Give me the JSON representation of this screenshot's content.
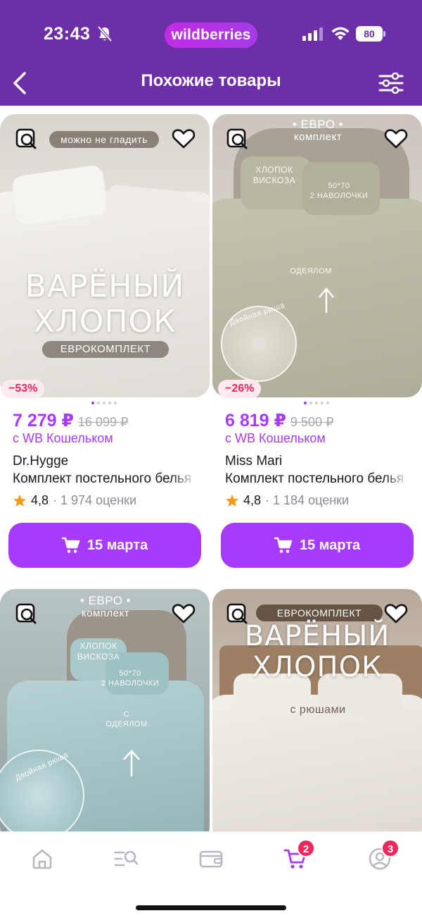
{
  "status_bar": {
    "time": "23:43",
    "brand": "wildberries",
    "battery": "80"
  },
  "header": {
    "title": "Похожие товары"
  },
  "products": [
    {
      "image": {
        "top_chip": "можно не гладить",
        "big_line1": "ВАРЁНЫЙ",
        "big_line2": "ХЛОПОК",
        "bottom_chip": "ЕВРОКОМПЛЕКТ"
      },
      "discount": "−53%",
      "price": "7 279 ₽",
      "old_price": "16 099 ₽",
      "wallet_text": "с WB Кошельком",
      "brand": "Dr.Hygge",
      "name": "Комплект постельного белья",
      "rating": "4,8",
      "reviews": "· 1 974 оценки",
      "delivery": "15 марта"
    },
    {
      "image": {
        "top_line1": "• ЕВРО •",
        "top_line2": "комплект",
        "label_fabric": "ХЛОПОК\nВИСКОЗА",
        "label_pillows": "50*70\n2 НАВОЛОЧКИ",
        "label_blanket": "ОДЕЯЛОМ",
        "label_ruffle": "Двойная рюша"
      },
      "discount": "−26%",
      "price": "6 819 ₽",
      "old_price": "9 500 ₽",
      "wallet_text": "с WB Кошельком",
      "brand": "Miss Mari",
      "name": "Комплект постельного белья",
      "rating": "4,8",
      "reviews": "· 1 184 оценки",
      "delivery": "15 марта"
    },
    {
      "image": {
        "top_line1": "• ЕВРО •",
        "top_line2": "комплект",
        "label_fabric": "ХЛОПОК\nВИСКОЗА",
        "label_pillows": "50*70\n2 НАВОЛОЧКИ",
        "label_blanket": "С\nОДЕЯЛОМ",
        "label_ruffle": "Двойная рюша"
      }
    },
    {
      "image": {
        "top_chip": "ЕВРОКОМПЛЕКТ",
        "big_line1": "ВАРЁНЫЙ",
        "big_line2": "ХЛОПОК",
        "caption": "с рюшами"
      }
    }
  ],
  "nav": {
    "cart_badge": "2",
    "profile_badge": "3"
  },
  "colors": {
    "header_bg": "#6c2fa8",
    "accent": "#a73afd",
    "badge": "#f0265c"
  }
}
